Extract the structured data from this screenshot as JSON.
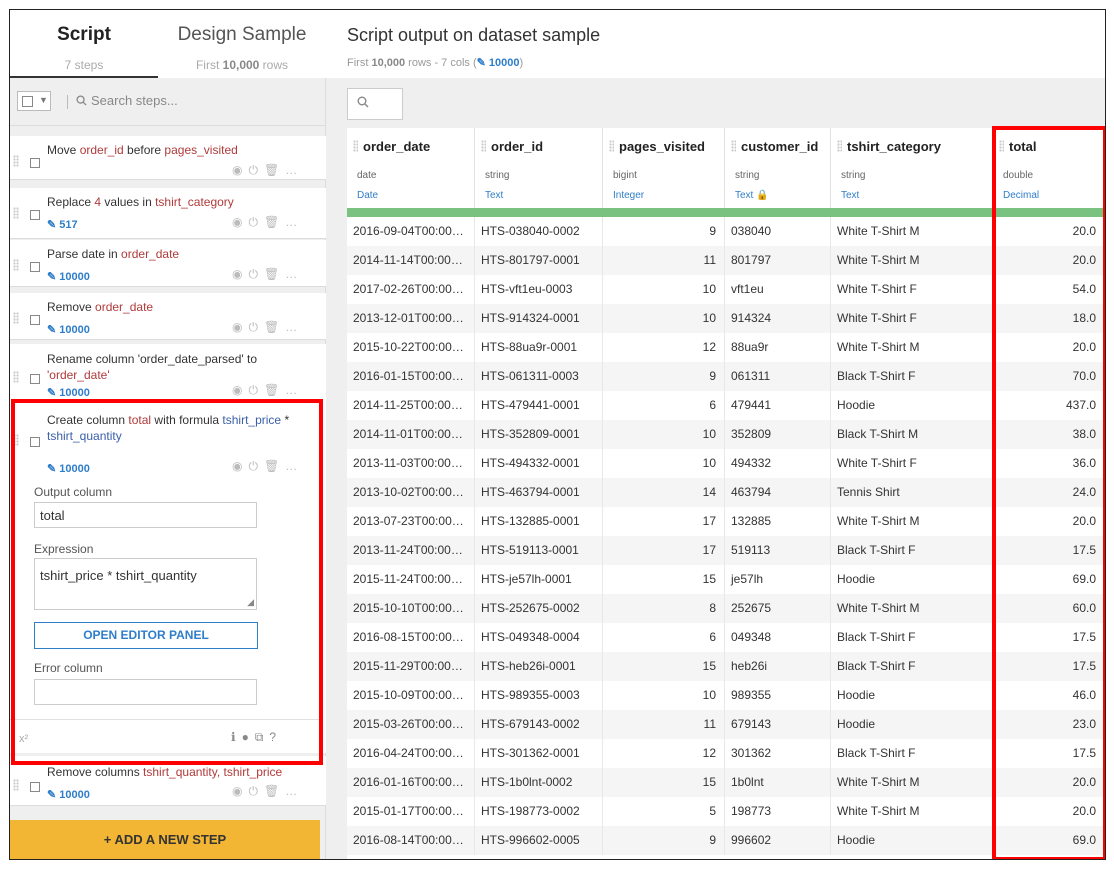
{
  "left": {
    "tabs": [
      {
        "title": "Script",
        "sub": "7 steps"
      },
      {
        "title": "Design Sample",
        "sub_prefix": "First ",
        "sub_bold": "10,000",
        "sub_suffix": " rows"
      }
    ],
    "search_placeholder": "Search steps...",
    "steps": [
      {
        "parts": [
          "Move ",
          "order_id",
          " before ",
          "pages_visited"
        ],
        "count": ""
      },
      {
        "parts": [
          "Replace ",
          "4",
          " values in ",
          "tshirt_category"
        ],
        "count": "517"
      },
      {
        "parts": [
          "Parse date in ",
          "order_date"
        ],
        "count": "10000"
      },
      {
        "parts": [
          "Remove ",
          "order_date"
        ],
        "count": "10000"
      },
      {
        "line1": "Rename column 'order_date_parsed' to",
        "line2": "'order_date'",
        "count": "10000"
      },
      {
        "parts": [
          "Create column ",
          "total",
          " with formula ",
          "tshirt_price",
          " *"
        ],
        "line2": "tshirt_quantity",
        "count": "10000"
      },
      {
        "parts": [
          "Remove columns ",
          "tshirt_quantity, tshirt_price"
        ],
        "count": "10000"
      }
    ],
    "form": {
      "output_label": "Output column",
      "output_value": "total",
      "expression_label": "Expression",
      "expression_value": "tshirt_price * tshirt_quantity",
      "open_editor": "OPEN EDITOR PANEL",
      "error_label": "Error column",
      "error_value": "",
      "formula_icon": "x²"
    },
    "add_step": "+ ADD A NEW STEP"
  },
  "right": {
    "title": "Script output on dataset sample",
    "sub_prefix": "First ",
    "sub_bold": "10,000",
    "sub_middle": " rows - 7 cols  (",
    "sub_count": "10000",
    "sub_suffix": ")",
    "columns": [
      {
        "name": "order_date",
        "type": "date",
        "meaning": "Date"
      },
      {
        "name": "order_id",
        "type": "string",
        "meaning": "Text"
      },
      {
        "name": "pages_visited",
        "type": "bigint",
        "meaning": "Integer"
      },
      {
        "name": "customer_id",
        "type": "string",
        "meaning": "Text"
      },
      {
        "name": "tshirt_category",
        "type": "string",
        "meaning": "Text"
      },
      {
        "name": "total",
        "type": "double",
        "meaning": "Decimal"
      }
    ],
    "rows": [
      [
        "2016-09-04T00:00…",
        "HTS-038040-0002",
        "9",
        "038040",
        "White T-Shirt M",
        "20.0"
      ],
      [
        "2014-11-14T00:00…",
        "HTS-801797-0001",
        "11",
        "801797",
        "White T-Shirt M",
        "20.0"
      ],
      [
        "2017-02-26T00:00…",
        "HTS-vft1eu-0003",
        "10",
        "vft1eu",
        "White T-Shirt F",
        "54.0"
      ],
      [
        "2013-12-01T00:00…",
        "HTS-914324-0001",
        "10",
        "914324",
        "White T-Shirt F",
        "18.0"
      ],
      [
        "2015-10-22T00:00…",
        "HTS-88ua9r-0001",
        "12",
        "88ua9r",
        "White T-Shirt M",
        "20.0"
      ],
      [
        "2016-01-15T00:00…",
        "HTS-061311-0003",
        "9",
        "061311",
        "Black T-Shirt F",
        "70.0"
      ],
      [
        "2014-11-25T00:00…",
        "HTS-479441-0001",
        "6",
        "479441",
        "Hoodie",
        "437.0"
      ],
      [
        "2014-11-01T00:00…",
        "HTS-352809-0001",
        "10",
        "352809",
        "Black T-Shirt M",
        "38.0"
      ],
      [
        "2013-11-03T00:00…",
        "HTS-494332-0001",
        "10",
        "494332",
        "White T-Shirt F",
        "36.0"
      ],
      [
        "2013-10-02T00:00…",
        "HTS-463794-0001",
        "14",
        "463794",
        "Tennis Shirt",
        "24.0"
      ],
      [
        "2013-07-23T00:00…",
        "HTS-132885-0001",
        "17",
        "132885",
        "White T-Shirt M",
        "20.0"
      ],
      [
        "2013-11-24T00:00…",
        "HTS-519113-0001",
        "17",
        "519113",
        "Black T-Shirt F",
        "17.5"
      ],
      [
        "2015-11-24T00:00…",
        "HTS-je57lh-0001",
        "15",
        "je57lh",
        "Hoodie",
        "69.0"
      ],
      [
        "2015-10-10T00:00…",
        "HTS-252675-0002",
        "8",
        "252675",
        "White T-Shirt M",
        "60.0"
      ],
      [
        "2016-08-15T00:00…",
        "HTS-049348-0004",
        "6",
        "049348",
        "Black T-Shirt F",
        "17.5"
      ],
      [
        "2015-11-29T00:00…",
        "HTS-heb26i-0001",
        "15",
        "heb26i",
        "Black T-Shirt F",
        "17.5"
      ],
      [
        "2015-10-09T00:00…",
        "HTS-989355-0003",
        "10",
        "989355",
        "Hoodie",
        "46.0"
      ],
      [
        "2015-03-26T00:00…",
        "HTS-679143-0002",
        "11",
        "679143",
        "Hoodie",
        "23.0"
      ],
      [
        "2016-04-24T00:00…",
        "HTS-301362-0001",
        "12",
        "301362",
        "Black T-Shirt F",
        "17.5"
      ],
      [
        "2016-01-16T00:00…",
        "HTS-1b0lnt-0002",
        "15",
        "1b0lnt",
        "White T-Shirt M",
        "20.0"
      ],
      [
        "2015-01-17T00:00…",
        "HTS-198773-0002",
        "5",
        "198773",
        "White T-Shirt M",
        "20.0"
      ],
      [
        "2016-08-14T00:00…",
        "HTS-996602-0005",
        "9",
        "996602",
        "Hoodie",
        "69.0"
      ]
    ]
  },
  "colors": {
    "accent": "#2f7ec9",
    "highlight": "#ff0000",
    "add_step": "#f2b634",
    "schema_bar": "#7ac27f"
  }
}
